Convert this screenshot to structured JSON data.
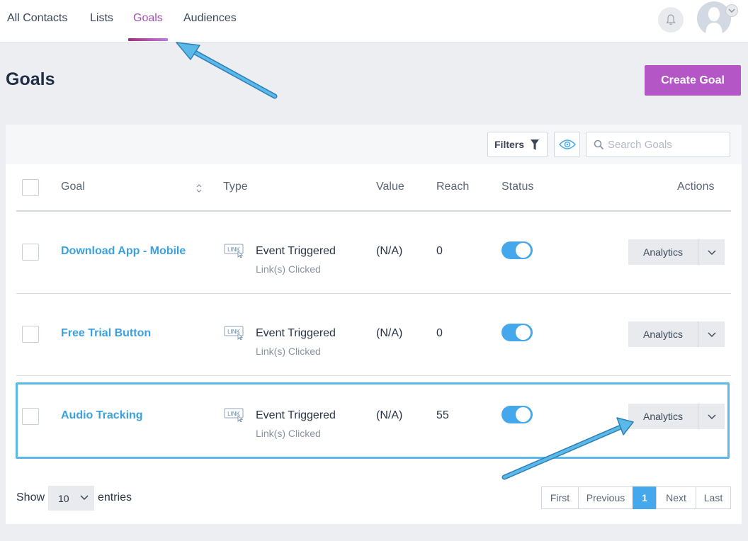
{
  "nav": {
    "tabs": [
      {
        "label": "All Contacts"
      },
      {
        "label": "Lists"
      },
      {
        "label": "Goals"
      },
      {
        "label": "Audiences"
      }
    ],
    "active_tab": "Goals"
  },
  "page": {
    "title": "Goals",
    "create_button": "Create Goal"
  },
  "toolbar": {
    "filters_label": "Filters",
    "search_placeholder": "Search Goals"
  },
  "table": {
    "columns": [
      "Goal",
      "Type",
      "Value",
      "Reach",
      "Status",
      "Actions"
    ],
    "rows": [
      {
        "goal": "Download App - Mobile",
        "type_icon": "link-icon",
        "type": "Event Triggered",
        "type_detail": "Link(s) Clicked",
        "value": "(N/A)",
        "reach": "0",
        "status_on": true,
        "action": "Analytics"
      },
      {
        "goal": "Free Trial Button",
        "type_icon": "link-icon",
        "type": "Event Triggered",
        "type_detail": "Link(s) Clicked",
        "value": "(N/A)",
        "reach": "0",
        "status_on": true,
        "action": "Analytics"
      },
      {
        "goal": "Audio Tracking",
        "type_icon": "link-icon",
        "type": "Event Triggered",
        "type_detail": "Link(s) Clicked",
        "value": "(N/A)",
        "reach": "55",
        "status_on": true,
        "action": "Analytics"
      }
    ],
    "type_icon_text": "LINK"
  },
  "footer": {
    "show_label": "Show",
    "entries_value": "10",
    "entries_label": "entries",
    "pagination": [
      "First",
      "Previous",
      "1",
      "Next",
      "Last"
    ],
    "current_page": "1"
  },
  "colors": {
    "accent": "#b556c6",
    "link": "#3ca0e0",
    "toggle_on": "#45a8ec",
    "annotation": "#5bb9ea"
  }
}
